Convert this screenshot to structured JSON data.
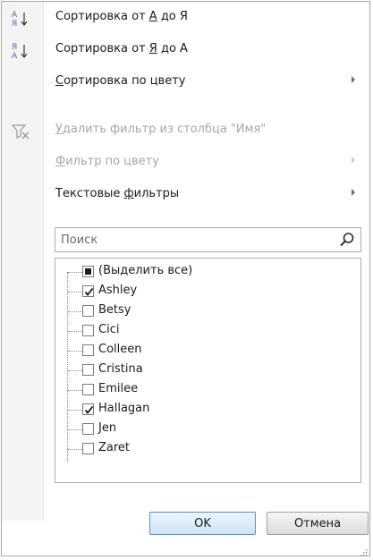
{
  "menu": {
    "sort_asc": {
      "label_prefix": "Сортировка от ",
      "label_a": "А",
      "label_mid": " до Я",
      "icon_top": "А",
      "icon_bottom": "Я"
    },
    "sort_desc": {
      "label_prefix": "Сортировка от ",
      "label_a": "Я",
      "label_mid": " до А",
      "icon_top": "Я",
      "icon_bottom": "А"
    },
    "sort_color": {
      "label_u": "С",
      "label_rest": "ортировка по цвету"
    },
    "clear_filter": {
      "label_u": "У",
      "label_rest": "далить фильтр из столбца \"Имя\""
    },
    "filter_color": {
      "label_u": "Ф",
      "label_rest": "ильтр по цвету"
    },
    "text_filters": {
      "label_prefix": "Текстовые ",
      "label_u": "ф",
      "label_rest": "ильтры"
    }
  },
  "search": {
    "placeholder": "Поиск"
  },
  "list": {
    "items": [
      {
        "label": "(Выделить все)",
        "state": "indeterminate"
      },
      {
        "label": "Ashley",
        "state": "checked"
      },
      {
        "label": "Betsy",
        "state": "unchecked"
      },
      {
        "label": "Cici",
        "state": "unchecked"
      },
      {
        "label": "Colleen",
        "state": "unchecked"
      },
      {
        "label": "Cristina",
        "state": "unchecked"
      },
      {
        "label": "Emilee",
        "state": "unchecked"
      },
      {
        "label": "Hallagan",
        "state": "checked"
      },
      {
        "label": "Jen",
        "state": "unchecked"
      },
      {
        "label": "Zaret",
        "state": "unchecked"
      }
    ]
  },
  "buttons": {
    "ok": "OK",
    "cancel": "Отмена"
  },
  "colors": {
    "accent": "#3c6fb4",
    "disabled": "#a6a6a6",
    "ok_border": "#5a8fc6"
  }
}
